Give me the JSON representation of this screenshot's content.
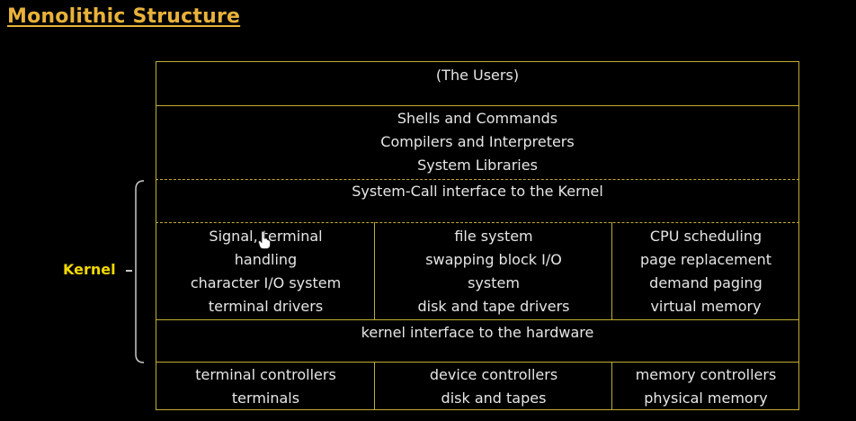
{
  "title": "Monolithic Structure",
  "kernel_label": "Kernel",
  "layers": {
    "users": "(The Users)",
    "apps": [
      "Shells and Commands",
      "Compilers and Interpreters",
      "System Libraries"
    ],
    "syscall": "System-Call interface to the Kernel",
    "kernel_columns": [
      [
        "Signal, terminal",
        "handling",
        "character I/O system",
        "terminal drivers"
      ],
      [
        "file system",
        "swapping block I/O",
        "system",
        "disk and tape drivers"
      ],
      [
        "CPU scheduling",
        "page replacement",
        "demand paging",
        "virtual memory"
      ]
    ],
    "hw_interface": "kernel interface to the hardware",
    "hardware_columns": [
      [
        "terminal controllers",
        "terminals"
      ],
      [
        "device controllers",
        "disk and tapes"
      ],
      [
        "memory controllers",
        "physical memory"
      ]
    ]
  },
  "colors": {
    "background": "#000000",
    "title": "#e8b23a",
    "kernel_label": "#f2d800",
    "border": "#bfae33",
    "text": "#e6e6e6"
  }
}
